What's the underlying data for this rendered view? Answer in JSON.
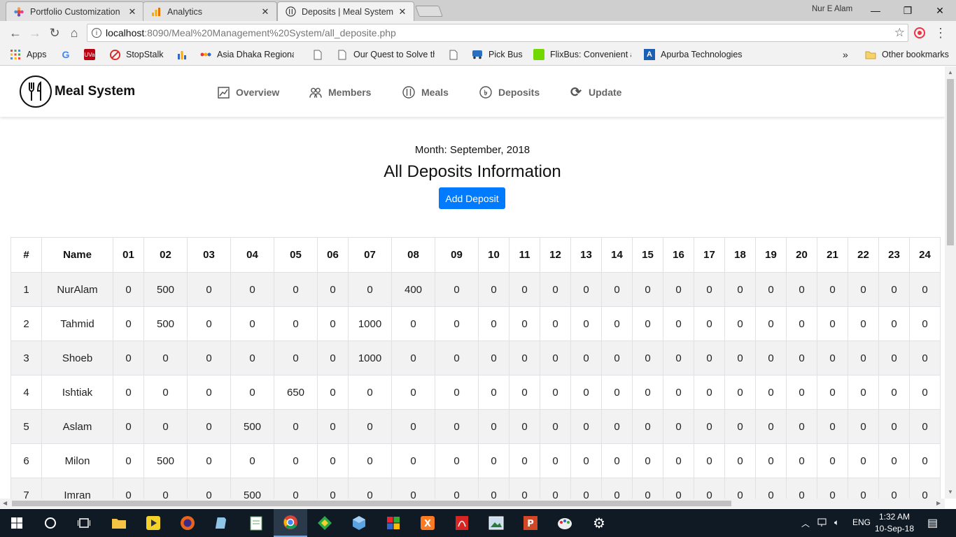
{
  "browser": {
    "tabs": [
      {
        "title": "Portfolio Customization",
        "active": false
      },
      {
        "title": "Analytics",
        "active": false
      },
      {
        "title": "Deposits | Meal System",
        "active": true
      }
    ],
    "profile_name": "Nur E Alam",
    "url_host": "localhost",
    "url_path": ":8090/Meal%20Management%20System/all_deposite.php",
    "bookmarks": [
      {
        "label": "Apps",
        "icon": "apps-grid-icon"
      },
      {
        "label": "",
        "icon": "google-icon"
      },
      {
        "label": "",
        "icon": "uva-icon"
      },
      {
        "label": "StopStalk",
        "icon": "stopstalk-icon"
      },
      {
        "label": "",
        "icon": "bar-chart-icon"
      },
      {
        "label": "Asia Dhaka Regional",
        "icon": "acm-icon"
      },
      {
        "label": "",
        "icon": "page-icon"
      },
      {
        "label": "Our Quest to Solve th",
        "icon": "page-icon"
      },
      {
        "label": "",
        "icon": "page-icon"
      },
      {
        "label": "Pick Bus",
        "icon": "bus-icon"
      },
      {
        "label": "FlixBus: Convenient a",
        "icon": "flixbus-icon"
      },
      {
        "label": "Apurba Technologies",
        "icon": "apurba-icon"
      },
      {
        "label": "Other bookmarks",
        "icon": "folder-icon"
      }
    ],
    "overflow": "»"
  },
  "site": {
    "brand": "Meal System",
    "nav": [
      {
        "label": "Overview",
        "icon": "chart-icon"
      },
      {
        "label": "Members",
        "icon": "users-icon"
      },
      {
        "label": "Meals",
        "icon": "utensils-icon"
      },
      {
        "label": "Deposits",
        "icon": "coin-icon"
      },
      {
        "label": "Update",
        "icon": "refresh-icon"
      }
    ]
  },
  "page": {
    "month_label": "Month: September, 2018",
    "title": "All Deposits Information",
    "add_button": "Add Deposit"
  },
  "table": {
    "headers": [
      "#",
      "Name",
      "01",
      "02",
      "03",
      "04",
      "05",
      "06",
      "07",
      "08",
      "09",
      "10",
      "11",
      "12",
      "13",
      "14",
      "15",
      "16",
      "17",
      "18",
      "19",
      "20",
      "21",
      "22",
      "23",
      "24"
    ],
    "rows": [
      [
        "1",
        "NurAlam",
        "0",
        "500",
        "0",
        "0",
        "0",
        "0",
        "0",
        "400",
        "0",
        "0",
        "0",
        "0",
        "0",
        "0",
        "0",
        "0",
        "0",
        "0",
        "0",
        "0",
        "0",
        "0",
        "0",
        "0"
      ],
      [
        "2",
        "Tahmid",
        "0",
        "500",
        "0",
        "0",
        "0",
        "0",
        "1000",
        "0",
        "0",
        "0",
        "0",
        "0",
        "0",
        "0",
        "0",
        "0",
        "0",
        "0",
        "0",
        "0",
        "0",
        "0",
        "0",
        "0"
      ],
      [
        "3",
        "Shoeb",
        "0",
        "0",
        "0",
        "0",
        "0",
        "0",
        "1000",
        "0",
        "0",
        "0",
        "0",
        "0",
        "0",
        "0",
        "0",
        "0",
        "0",
        "0",
        "0",
        "0",
        "0",
        "0",
        "0",
        "0"
      ],
      [
        "4",
        "Ishtiak",
        "0",
        "0",
        "0",
        "0",
        "650",
        "0",
        "0",
        "0",
        "0",
        "0",
        "0",
        "0",
        "0",
        "0",
        "0",
        "0",
        "0",
        "0",
        "0",
        "0",
        "0",
        "0",
        "0",
        "0"
      ],
      [
        "5",
        "Aslam",
        "0",
        "0",
        "0",
        "500",
        "0",
        "0",
        "0",
        "0",
        "0",
        "0",
        "0",
        "0",
        "0",
        "0",
        "0",
        "0",
        "0",
        "0",
        "0",
        "0",
        "0",
        "0",
        "0",
        "0"
      ],
      [
        "6",
        "Milon",
        "0",
        "500",
        "0",
        "0",
        "0",
        "0",
        "0",
        "0",
        "0",
        "0",
        "0",
        "0",
        "0",
        "0",
        "0",
        "0",
        "0",
        "0",
        "0",
        "0",
        "0",
        "0",
        "0",
        "0"
      ],
      [
        "7",
        "Imran",
        "0",
        "0",
        "0",
        "500",
        "0",
        "0",
        "0",
        "0",
        "0",
        "0",
        "0",
        "0",
        "0",
        "0",
        "0",
        "0",
        "0",
        "0",
        "0",
        "0",
        "0",
        "0",
        "0",
        "0"
      ]
    ]
  },
  "taskbar": {
    "language": "ENG",
    "time": "1:32 AM",
    "date": "10-Sep-18"
  },
  "colors": {
    "primary_button": "#007bff",
    "taskbar": "#101a24",
    "stripe": "#f2f2f2"
  }
}
